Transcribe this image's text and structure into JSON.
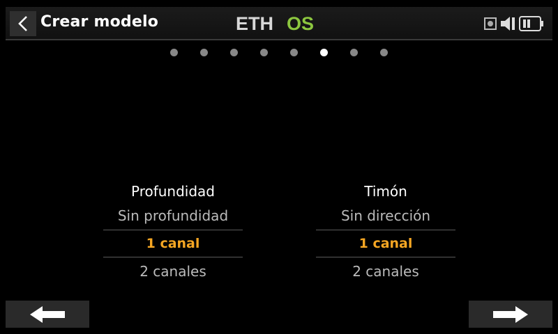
{
  "header": {
    "title": "Crear modelo",
    "logo_text_left": "ETH",
    "logo_text_right": "OS",
    "logo_accent": "#8cc63f",
    "icons": [
      "back-icon",
      "record-icon",
      "volume-icon",
      "battery-icon"
    ]
  },
  "pager": {
    "total": 8,
    "active_index": 5
  },
  "columns": [
    {
      "heading": "Profundidad",
      "options": [
        "Sin profundidad",
        "1 canal",
        "2 canales"
      ],
      "selected": "1 canal"
    },
    {
      "heading": "Timón",
      "options": [
        "Sin dirección",
        "1 canal",
        "2 canales"
      ],
      "selected": "1 canal"
    }
  ],
  "nav": {
    "prev": "arrow-left-icon",
    "next": "arrow-right-icon"
  },
  "colors": {
    "selected": "#f5a623",
    "background": "#000000",
    "button": "#2a2a2a"
  }
}
